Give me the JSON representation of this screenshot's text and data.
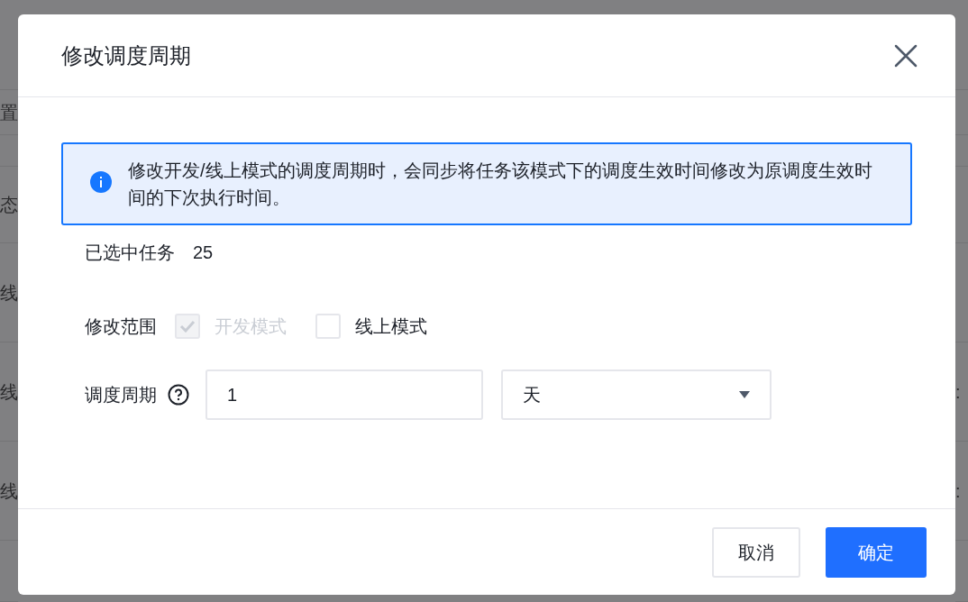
{
  "background": {
    "rows": [
      {},
      {
        "left": "置"
      },
      {},
      {
        "left": "态"
      },
      {
        "left": "线"
      },
      {
        "left": "线",
        "right": ":"
      },
      {
        "left": "线",
        "right": ":"
      },
      {}
    ]
  },
  "dialog": {
    "title": "修改调度周期",
    "alert": {
      "text": "修改开发/线上模式的调度周期时，会同步将任务该模式下的调度生效时间修改为原调度生效时间的下次执行时间。"
    },
    "selected_tasks": {
      "label": "已选中任务",
      "value": "25"
    },
    "scope": {
      "label": "修改范围",
      "options": [
        {
          "label": "开发模式",
          "checked": true,
          "disabled": true
        },
        {
          "label": "线上模式",
          "checked": false,
          "disabled": false
        }
      ]
    },
    "period": {
      "label": "调度周期",
      "value": "1",
      "unit": "天"
    },
    "buttons": [
      {
        "label": "取消",
        "kind": "default"
      },
      {
        "label": "确定",
        "kind": "primary"
      }
    ]
  }
}
